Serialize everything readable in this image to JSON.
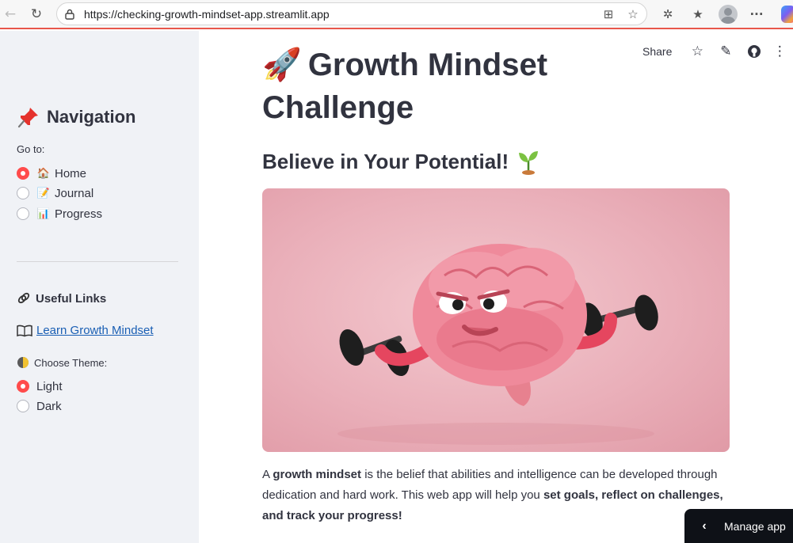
{
  "browser": {
    "url": "https://checking-growth-mindset-app.streamlit.app"
  },
  "sidebar": {
    "nav_icon": "pushpin-icon",
    "nav_title": "Navigation",
    "goto_label": "Go to:",
    "nav_options": [
      {
        "icon": "house-icon",
        "glyph": "🏠",
        "label": "Home",
        "selected": true
      },
      {
        "icon": "memo-icon",
        "glyph": "📝",
        "label": "Journal",
        "selected": false
      },
      {
        "icon": "bar-chart-icon",
        "glyph": "📊",
        "label": "Progress",
        "selected": false
      }
    ],
    "links_title": "Useful Links",
    "learn_link": "Learn Growth Mindset",
    "theme_label": "Choose Theme:",
    "theme_options": [
      {
        "label": "Light",
        "selected": true
      },
      {
        "label": "Dark",
        "selected": false
      }
    ]
  },
  "header": {
    "share_label": "Share"
  },
  "main": {
    "title": "Growth Mindset Challenge",
    "title_icon": "rocket-icon",
    "subtitle": "Believe in Your Potential!",
    "subtitle_icon": "seedling-icon",
    "hero_icon": "brain-lifting-dumbbells-image",
    "body": {
      "p1": "A ",
      "b1": "growth mindset",
      "p2": " is the belief that abilities and intelligence can be developed through dedication and hard work. This web app will help you ",
      "b2": "set goals, reflect on challenges, and track your progress!"
    }
  },
  "manage_app": {
    "label": "Manage app"
  },
  "colors": {
    "accent": "#ff4b4b",
    "sidebar_bg": "#f0f2f6",
    "text": "#31333f",
    "link": "#1a5fb4",
    "hero_bg": "#eab0ba"
  }
}
